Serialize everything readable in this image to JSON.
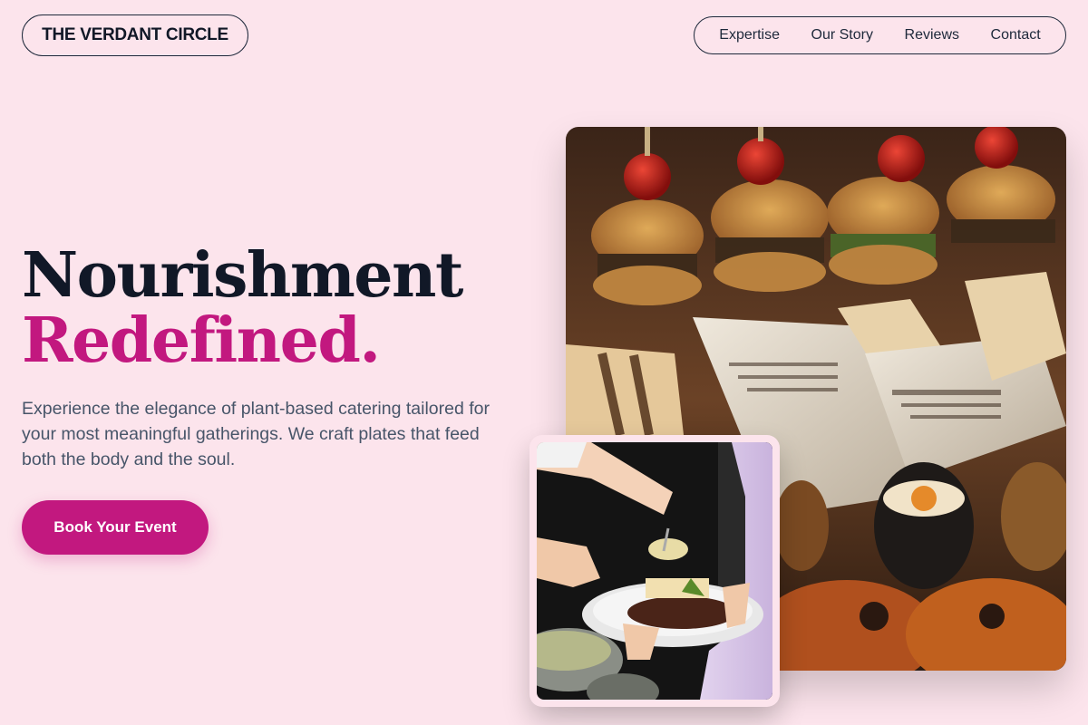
{
  "brand": {
    "name": "THE VERDANT CIRCLE"
  },
  "nav": {
    "items": [
      {
        "label": "Expertise"
      },
      {
        "label": "Our Story"
      },
      {
        "label": "Reviews"
      },
      {
        "label": "Contact"
      }
    ]
  },
  "hero": {
    "title_line1": "Nourishment",
    "title_line2": "Redefined.",
    "description": "Experience the elegance of plant-based catering tailored for your most meaningful gatherings. We craft plates that feed both the body and the soul.",
    "cta_label": "Book Your Event"
  },
  "images": {
    "main": {
      "icon": "food-platter-photo"
    },
    "secondary": {
      "icon": "plate-serving-photo"
    }
  },
  "colors": {
    "background": "#fce4ec",
    "accent": "#c2187f",
    "heading": "#111827",
    "body_text": "#475569"
  }
}
